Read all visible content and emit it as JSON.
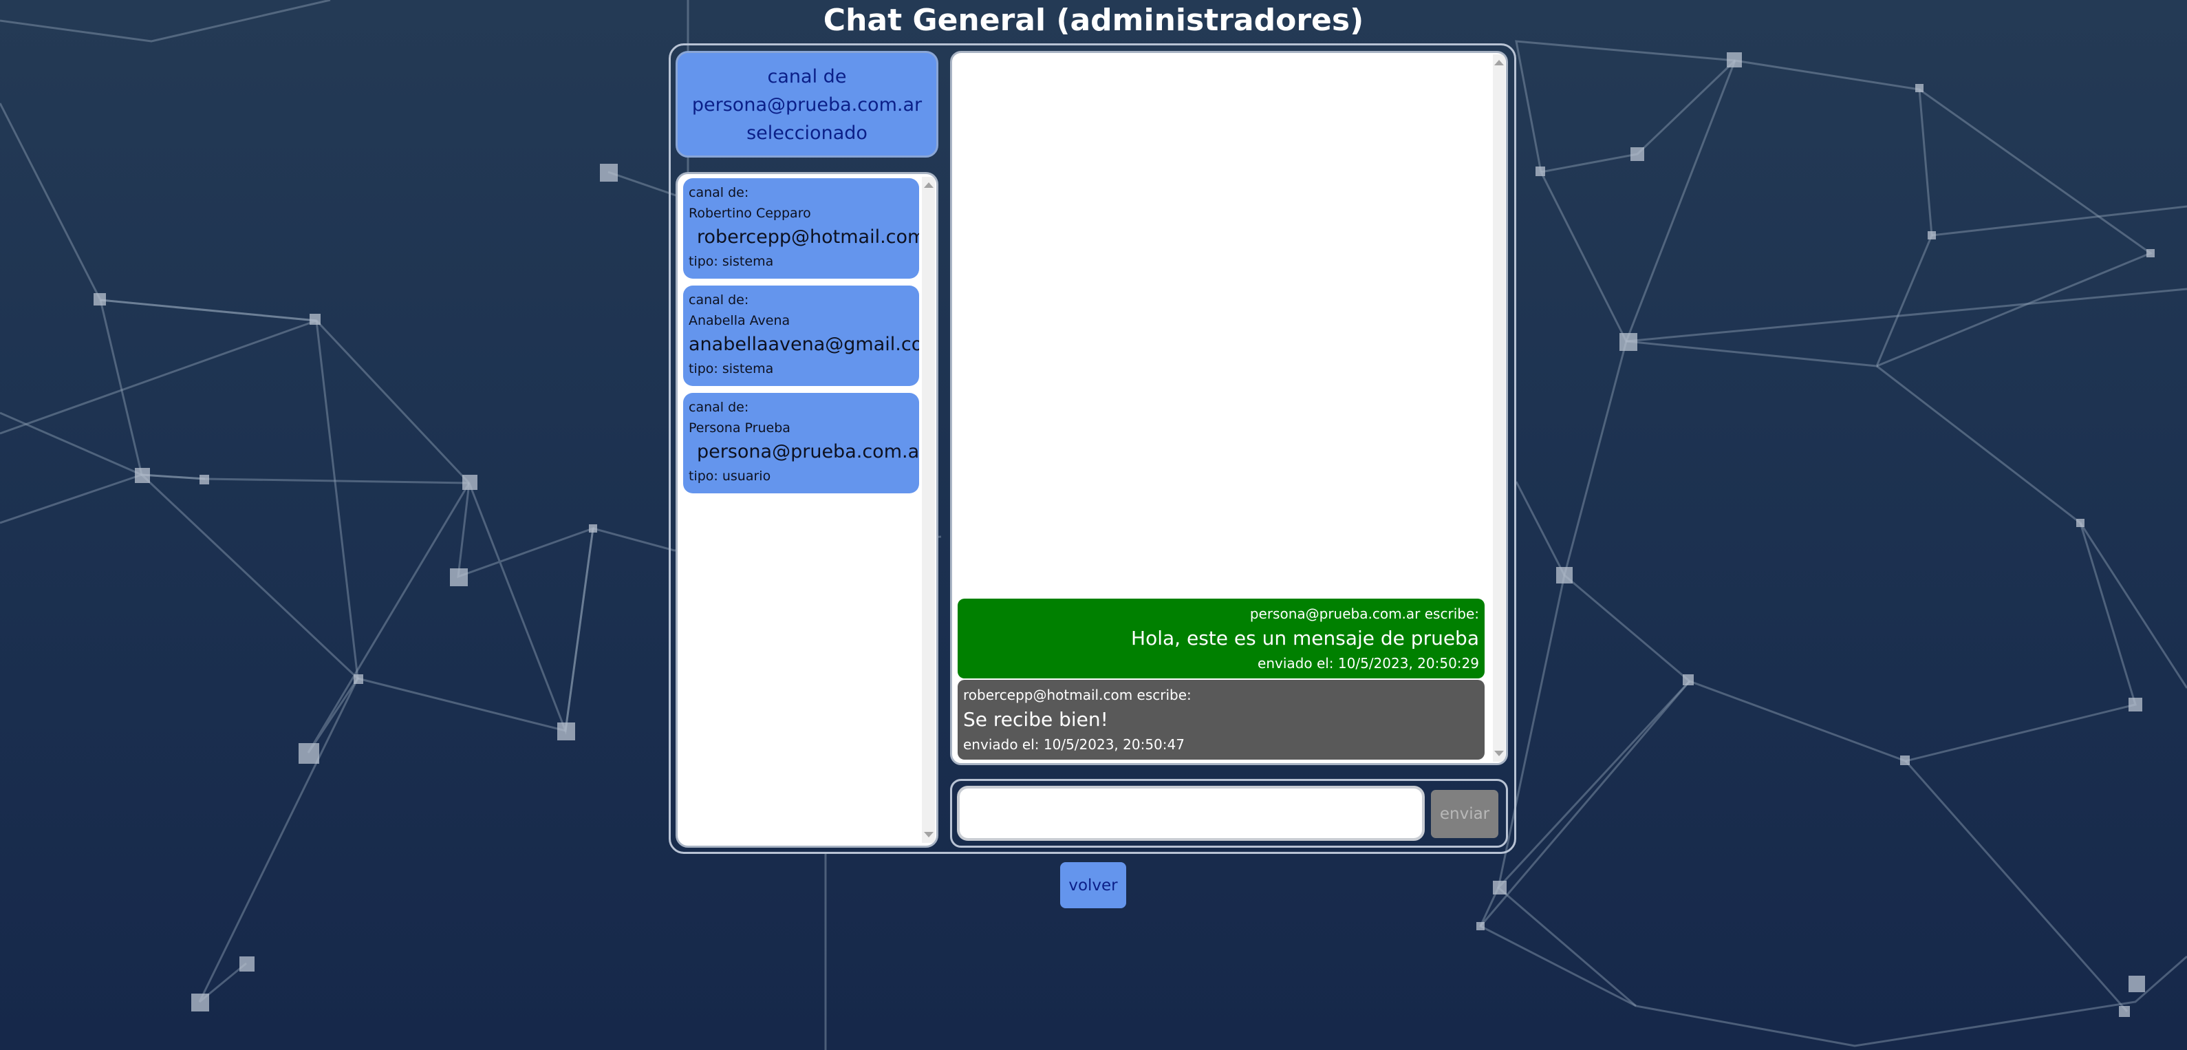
{
  "page": {
    "title": "Chat General (administradores)"
  },
  "selected_channel": {
    "line1": "canal de",
    "line2": "persona@prueba.com.ar",
    "line3": "seleccionado"
  },
  "channels": [
    {
      "prefix": "canal de:",
      "name": "Robertino Cepparo",
      "email": "robercepp@hotmail.com",
      "type": "tipo: sistema"
    },
    {
      "prefix": "canal de:",
      "name": "Anabella Avena",
      "email": "anabellaavena@gmail.com",
      "type": "tipo: sistema"
    },
    {
      "prefix": "canal de:",
      "name": "Persona Prueba",
      "email": "persona@prueba.com.ar",
      "type": "tipo: usuario"
    }
  ],
  "messages": [
    {
      "author": "persona@prueba.com.ar escribe:",
      "text": "Hola, este es un mensaje de prueba",
      "sent": "enviado el: 10/5/2023, 20:50:29",
      "own": true,
      "color": "#008000"
    },
    {
      "author": "robercepp@hotmail.com escribe:",
      "text": "Se recibe bien!",
      "sent": "enviado el: 10/5/2023, 20:50:47",
      "own": false,
      "color": "#595959"
    }
  ],
  "composer": {
    "value": "",
    "placeholder": "",
    "send_label": "enviar"
  },
  "footer": {
    "back_label": "volver"
  },
  "colors": {
    "accent": "#6495ed",
    "background": "#1c3150",
    "own_message": "#008000",
    "other_message": "#595959"
  }
}
